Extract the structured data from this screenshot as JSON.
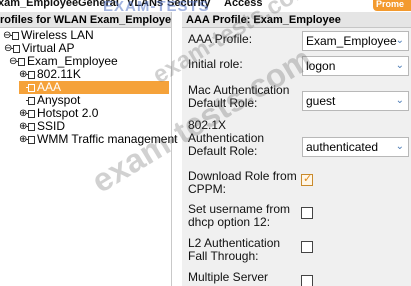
{
  "menubar": {
    "items": [
      "xam_Employee",
      "General",
      "VLANs",
      "Security",
      "Access",
      "Prome"
    ]
  },
  "tree": {
    "header": "rofiles for WLAN Exam_Employee",
    "nodes": [
      {
        "label": "Wireless LAN",
        "toggle": "⊖"
      },
      {
        "label": "Virtual AP",
        "toggle": "⊖"
      },
      {
        "label": "Exam_Employee",
        "toggle": "⊖"
      },
      {
        "label": "802.11K",
        "toggle": "⊕"
      },
      {
        "label": "AAA",
        "toggle": "",
        "selected": true
      },
      {
        "label": "Anyspot",
        "toggle": ""
      },
      {
        "label": "Hotspot 2.0",
        "toggle": "⊕"
      },
      {
        "label": "SSID",
        "toggle": "⊕"
      },
      {
        "label": "WMM Traffic management",
        "toggle": "⊕"
      }
    ]
  },
  "form": {
    "header": "AAA Profile: Exam_Employee",
    "aaa_profile": {
      "label": "AAA Profile:",
      "value": "Exam_Employee"
    },
    "initial_role": {
      "label": "Initial role:",
      "value": "logon"
    },
    "mac_auth_default_role": {
      "label_line1": "Mac Authentication",
      "label_line2": "Default Role:",
      "value": "guest"
    },
    "auth_8021x_default_role": {
      "label_line1": "802.1X",
      "label_line2": "Authentication",
      "label_line3": "Default Role:",
      "value": "authenticated"
    },
    "download_role_cppm": {
      "label_line1": "Download Role from",
      "label_line2": "CPPM:",
      "checked": true
    },
    "set_username_dhcp": {
      "label_line1": "Set username from",
      "label_line2": "dhcp option 12:",
      "checked": false
    },
    "l2_auth_fall_through": {
      "label_line1": "L2 Authentication",
      "label_line2": "Fall Through:",
      "checked": false
    },
    "multiple_server": {
      "label_line1": "Multiple Server",
      "checked": false
    }
  },
  "watermark": {
    "large": "exam-tests.com",
    "small": "exam-tests.com",
    "logo": "EXAM-TESTS"
  },
  "colors": {
    "selected_row": "#f5a23a",
    "accent": "#f39a2e",
    "panel_bg": "#f0f0f0",
    "header_bg": "#e5e5e5"
  }
}
